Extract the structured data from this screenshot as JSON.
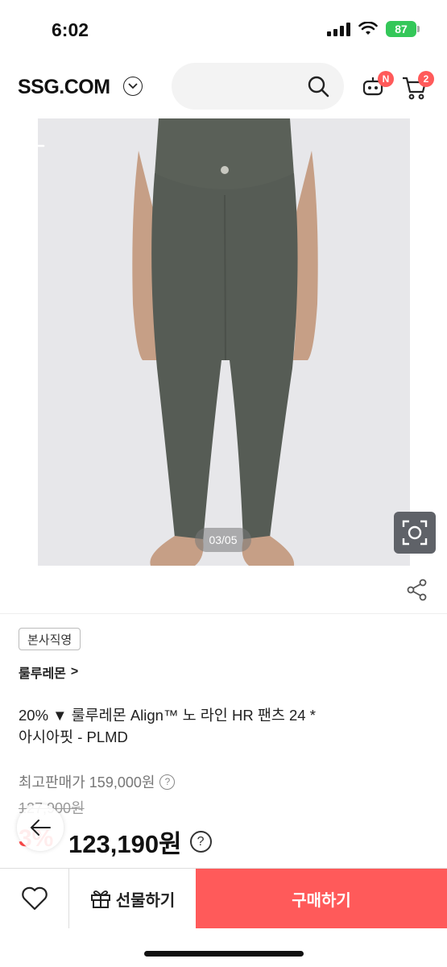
{
  "status_bar": {
    "time": "6:02",
    "battery": "87"
  },
  "header": {
    "logo": "SSG.COM",
    "notification_badge": "N",
    "cart_count": "2"
  },
  "gallery": {
    "counter": "03/05"
  },
  "product": {
    "tag": "본사직영",
    "brand": "룰루레몬",
    "brand_arrow": ">",
    "title_line1": "20% ▼ 룰루레몬 Align™ 노 라인 HR 팬츠 24 *",
    "title_line2": "아시아핏 - PLMD",
    "original_price_label": "최고판매가 159,000원",
    "strike_price": "127,900원",
    "discount": "3%",
    "final_price": "123,190원"
  },
  "bottom_bar": {
    "gift_label": "선물하기",
    "buy_label": "구매하기"
  },
  "colors": {
    "accent": "#ff5a5a",
    "leggings": "#565c55"
  }
}
